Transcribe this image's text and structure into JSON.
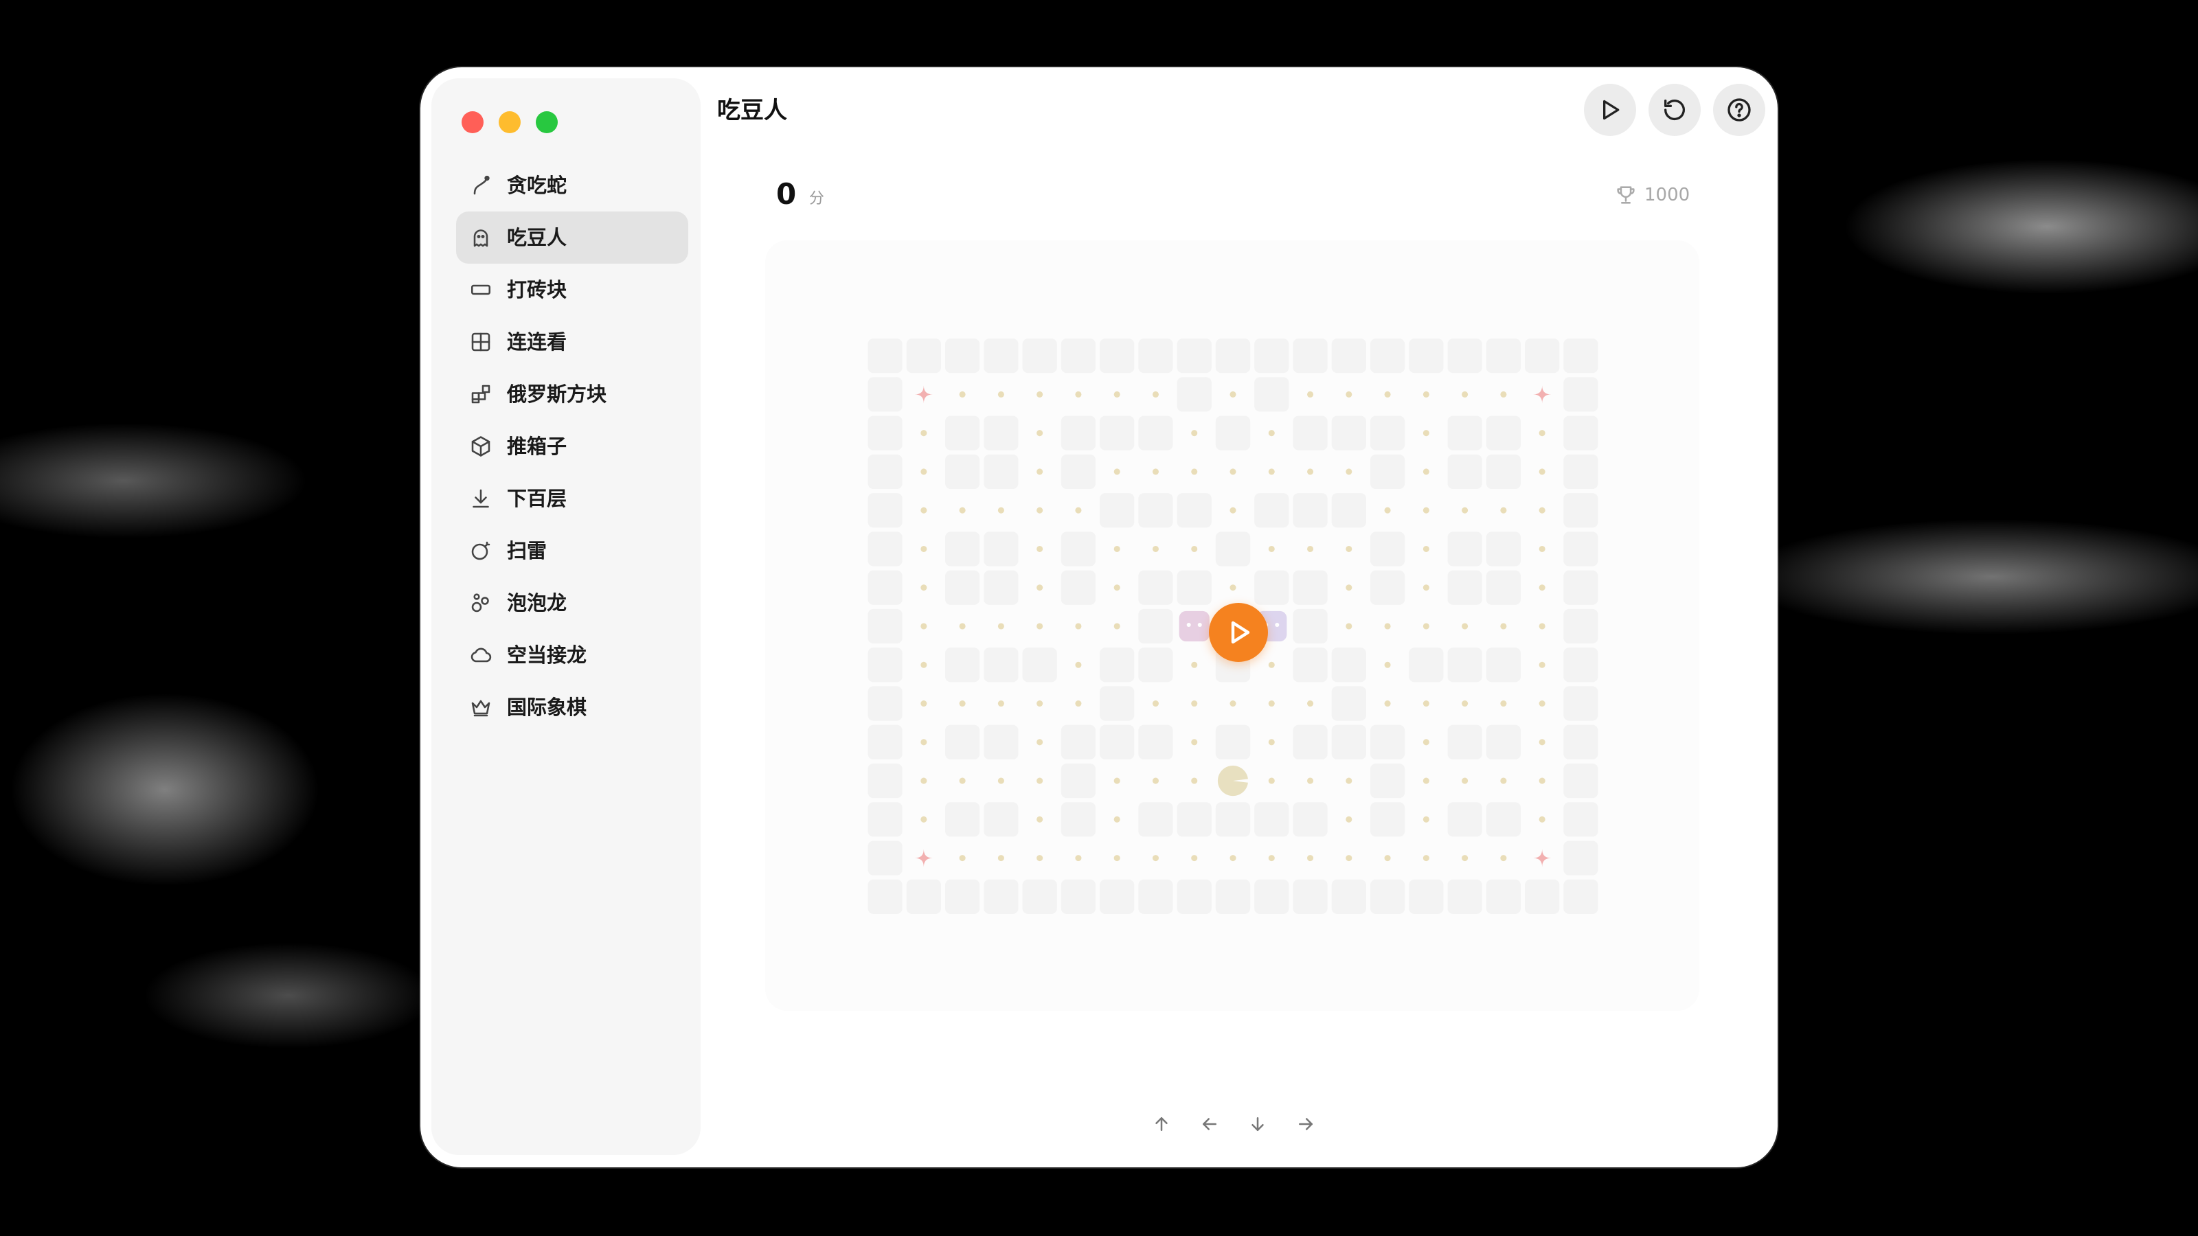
{
  "window": {
    "title": "吃豆人"
  },
  "sidebar": {
    "items": [
      {
        "label": "贪吃蛇",
        "icon": "snake-curve-icon",
        "active": false
      },
      {
        "label": "吃豆人",
        "icon": "ghost-icon",
        "active": true
      },
      {
        "label": "打砖块",
        "icon": "brick-rectangle-icon",
        "active": false
      },
      {
        "label": "连连看",
        "icon": "grid-icon",
        "active": false
      },
      {
        "label": "俄罗斯方块",
        "icon": "blocks-icon",
        "active": false
      },
      {
        "label": "推箱子",
        "icon": "box-icon",
        "active": false
      },
      {
        "label": "下百层",
        "icon": "arrow-down-bar-icon",
        "active": false
      },
      {
        "label": "扫雷",
        "icon": "bomb-icon",
        "active": false
      },
      {
        "label": "泡泡龙",
        "icon": "bubbles-icon",
        "active": false
      },
      {
        "label": "空当接龙",
        "icon": "cloud-icon",
        "active": false
      },
      {
        "label": "国际象棋",
        "icon": "crown-icon",
        "active": false
      }
    ]
  },
  "toolbar": {
    "play_icon": "play-icon",
    "restart_icon": "restart-icon",
    "help_icon": "help-icon"
  },
  "game": {
    "score": "0",
    "score_unit": "分",
    "best_score": "1000",
    "best_icon": "trophy-icon",
    "start_icon": "play-icon",
    "colors": {
      "accent": "#f5821f",
      "wall": "#f3f3f3",
      "dot": "#e9ddb8",
      "power": "#f2b0b0",
      "pacman": "#e8e0c0",
      "ghost_left": "#e7cfe2",
      "ghost_right": "#ddd5ee"
    }
  },
  "controls": {
    "up": "↑",
    "left": "←",
    "down": "↓",
    "right": "→"
  }
}
